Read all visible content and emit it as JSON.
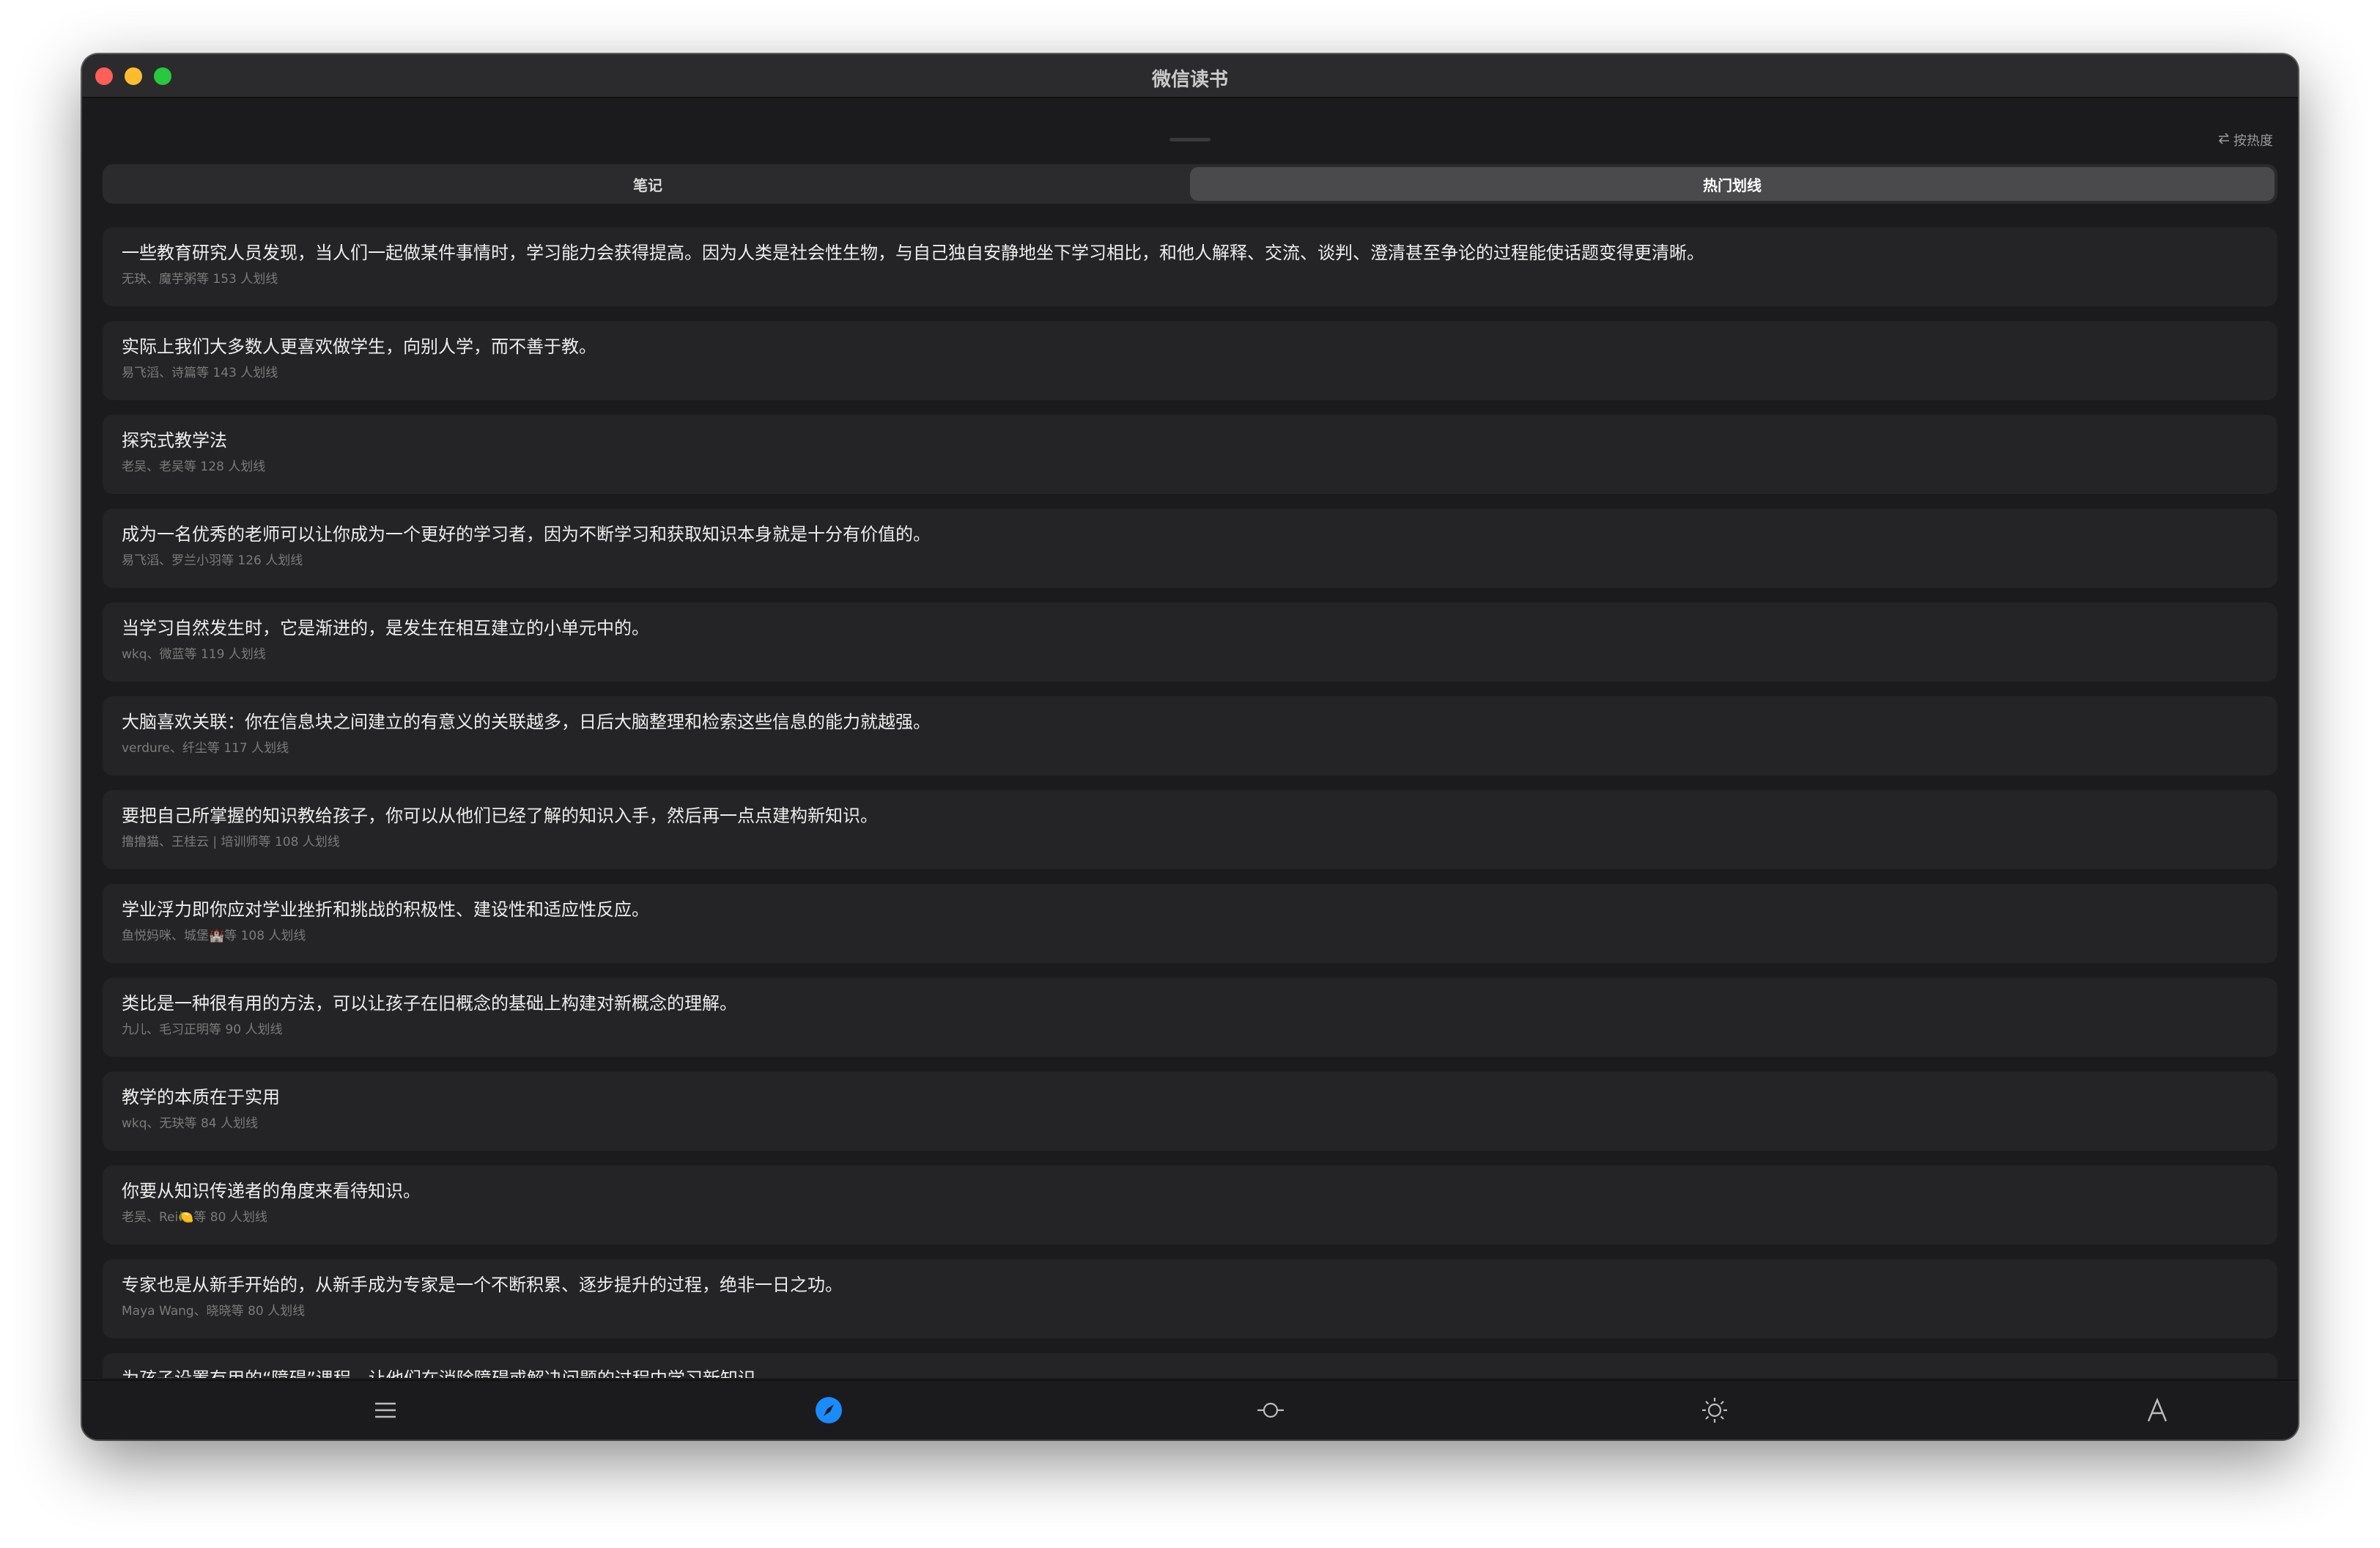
{
  "window": {
    "title": "微信读书"
  },
  "toolbar": {
    "sort_label": "按热度",
    "sort_icon": "swap-arrows-icon"
  },
  "tabs": [
    {
      "label": "笔记",
      "selected": false
    },
    {
      "label": "热门划线",
      "selected": true
    }
  ],
  "highlights": [
    {
      "text": "一些教育研究人员发现，当人们一起做某件事情时，学习能力会获得提高。因为人类是社会性生物，与自己独自安静地坐下学习相比，和他人解释、交流、谈判、澄清甚至争论的过程能使话题变得更清晰。",
      "meta": "无玦、魔芋粥等 153 人划线"
    },
    {
      "text": "实际上我们大多数人更喜欢做学生，向别人学，而不善于教。",
      "meta": "易飞滔、诗篇等 143 人划线"
    },
    {
      "text": "探究式教学法",
      "meta": "老吴、老吴等 128 人划线"
    },
    {
      "text": "成为一名优秀的老师可以让你成为一个更好的学习者，因为不断学习和获取知识本身就是十分有价值的。",
      "meta": "易飞滔、罗兰小羽等 126 人划线"
    },
    {
      "text": "当学习自然发生时，它是渐进的，是发生在相互建立的小单元中的。",
      "meta": "wkq、微蓝等 119 人划线"
    },
    {
      "text": "大脑喜欢关联：你在信息块之间建立的有意义的关联越多，日后大脑整理和检索这些信息的能力就越强。",
      "meta": "verdure、纤尘等 117 人划线"
    },
    {
      "text": "要把自己所掌握的知识教给孩子，你可以从他们已经了解的知识入手，然后再一点点建构新知识。",
      "meta": "撸撸猫、王桂云 | 培训师等 108 人划线"
    },
    {
      "text": "学业浮力即你应对学业挫折和挑战的积极性、建设性和适应性反应。",
      "meta": "鱼悦妈咪、城堡🏰等 108 人划线"
    },
    {
      "text": "类比是一种很有用的方法，可以让孩子在旧概念的基础上构建对新概念的理解。",
      "meta": "九儿、毛习正明等 90 人划线"
    },
    {
      "text": "教学的本质在于实用",
      "meta": "wkq、无玦等 84 人划线"
    },
    {
      "text": "你要从知识传递者的角度来看待知识。",
      "meta": "老吴、Rei🍋等 80 人划线"
    },
    {
      "text": "专家也是从新手开始的，从新手成为专家是一个不断积累、逐步提升的过程，绝非一日之功。",
      "meta": "Maya Wang、晓晓等 80 人划线"
    },
    {
      "text": "为孩子设置有用的“障碍”课程，让他们在消除障碍或解决问题的过程中学习新知识。",
      "meta": ""
    }
  ],
  "bottom_tabs": [
    {
      "icon": "list-icon",
      "active": false
    },
    {
      "icon": "compass-icon",
      "active": true
    },
    {
      "icon": "progress-slider-icon",
      "active": false
    },
    {
      "icon": "brightness-icon",
      "active": false
    },
    {
      "icon": "font-icon",
      "active": false
    }
  ],
  "colors": {
    "accent": "#1a8cff",
    "background": "#1b1b1d",
    "card": "#242426"
  }
}
